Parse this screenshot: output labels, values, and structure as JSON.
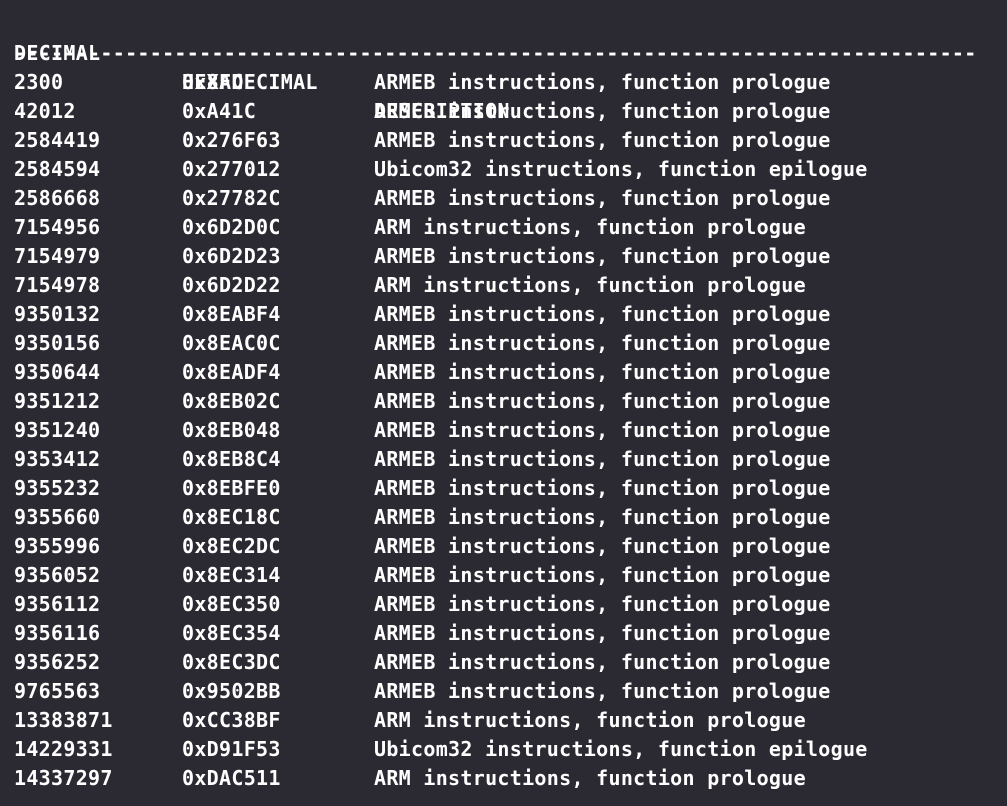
{
  "header": {
    "decimal": "DECIMAL",
    "hexadecimal": "HEXADECIMAL",
    "description": "DESCRIPTION"
  },
  "separator": "--------------------------------------------------------------------------------",
  "rows": [
    {
      "decimal": "2300",
      "hex": "0x8FC",
      "description": "ARMEB instructions, function prologue"
    },
    {
      "decimal": "42012",
      "hex": "0xA41C",
      "description": "ARMEB instructions, function prologue"
    },
    {
      "decimal": "2584419",
      "hex": "0x276F63",
      "description": "ARMEB instructions, function prologue"
    },
    {
      "decimal": "2584594",
      "hex": "0x277012",
      "description": "Ubicom32 instructions, function epilogue"
    },
    {
      "decimal": "2586668",
      "hex": "0x27782C",
      "description": "ARMEB instructions, function prologue"
    },
    {
      "decimal": "7154956",
      "hex": "0x6D2D0C",
      "description": "ARM instructions, function prologue"
    },
    {
      "decimal": "7154979",
      "hex": "0x6D2D23",
      "description": "ARMEB instructions, function prologue"
    },
    {
      "decimal": "7154978",
      "hex": "0x6D2D22",
      "description": "ARM instructions, function prologue"
    },
    {
      "decimal": "9350132",
      "hex": "0x8EABF4",
      "description": "ARMEB instructions, function prologue"
    },
    {
      "decimal": "9350156",
      "hex": "0x8EAC0C",
      "description": "ARMEB instructions, function prologue"
    },
    {
      "decimal": "9350644",
      "hex": "0x8EADF4",
      "description": "ARMEB instructions, function prologue"
    },
    {
      "decimal": "9351212",
      "hex": "0x8EB02C",
      "description": "ARMEB instructions, function prologue"
    },
    {
      "decimal": "9351240",
      "hex": "0x8EB048",
      "description": "ARMEB instructions, function prologue"
    },
    {
      "decimal": "9353412",
      "hex": "0x8EB8C4",
      "description": "ARMEB instructions, function prologue"
    },
    {
      "decimal": "9355232",
      "hex": "0x8EBFE0",
      "description": "ARMEB instructions, function prologue"
    },
    {
      "decimal": "9355660",
      "hex": "0x8EC18C",
      "description": "ARMEB instructions, function prologue"
    },
    {
      "decimal": "9355996",
      "hex": "0x8EC2DC",
      "description": "ARMEB instructions, function prologue"
    },
    {
      "decimal": "9356052",
      "hex": "0x8EC314",
      "description": "ARMEB instructions, function prologue"
    },
    {
      "decimal": "9356112",
      "hex": "0x8EC350",
      "description": "ARMEB instructions, function prologue"
    },
    {
      "decimal": "9356116",
      "hex": "0x8EC354",
      "description": "ARMEB instructions, function prologue"
    },
    {
      "decimal": "9356252",
      "hex": "0x8EC3DC",
      "description": "ARMEB instructions, function prologue"
    },
    {
      "decimal": "9765563",
      "hex": "0x9502BB",
      "description": "ARMEB instructions, function prologue"
    },
    {
      "decimal": "13383871",
      "hex": "0xCC38BF",
      "description": "ARM instructions, function prologue"
    },
    {
      "decimal": "14229331",
      "hex": "0xD91F53",
      "description": "Ubicom32 instructions, function epilogue"
    },
    {
      "decimal": "14337297",
      "hex": "0xDAC511",
      "description": "ARM instructions, function prologue"
    }
  ]
}
